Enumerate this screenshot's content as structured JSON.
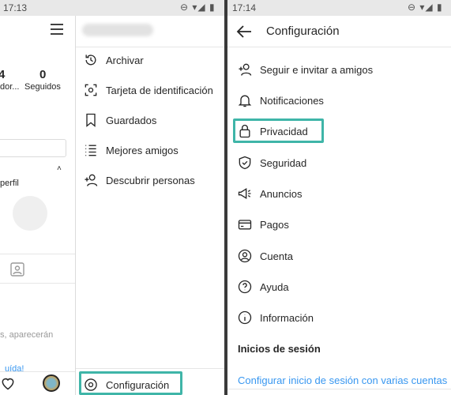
{
  "left_screen": {
    "status_time": "17:13",
    "profile_stats": {
      "followers_count": "4",
      "followers_label": "dor...",
      "following_count": "0",
      "following_label": "Seguidos"
    },
    "profile_section_label": "perfil",
    "empty_text": "s, aparecerán",
    "link_text": "uída!"
  },
  "drawer": {
    "items": [
      {
        "label": "Archivar",
        "icon": "archive-icon"
      },
      {
        "label": "Tarjeta de identificación",
        "icon": "nametag-icon"
      },
      {
        "label": "Guardados",
        "icon": "bookmark-icon"
      },
      {
        "label": "Mejores amigos",
        "icon": "close-friends-icon"
      },
      {
        "label": "Descubrir personas",
        "icon": "add-person-icon"
      }
    ],
    "settings_label": "Configuración"
  },
  "right_screen": {
    "status_time": "17:14",
    "title": "Configuración",
    "items": [
      {
        "label": "Seguir e invitar a amigos",
        "icon": "add-person-icon"
      },
      {
        "label": "Notificaciones",
        "icon": "bell-icon"
      },
      {
        "label": "Privacidad",
        "icon": "lock-icon"
      },
      {
        "label": "Seguridad",
        "icon": "shield-icon"
      },
      {
        "label": "Anuncios",
        "icon": "megaphone-icon"
      },
      {
        "label": "Pagos",
        "icon": "card-icon"
      },
      {
        "label": "Cuenta",
        "icon": "account-icon"
      },
      {
        "label": "Ayuda",
        "icon": "help-icon"
      },
      {
        "label": "Información",
        "icon": "info-icon"
      }
    ],
    "login_section_title": "Inicios de sesión",
    "multi_login_link": "Configurar inicio de sesión con varias cuentas"
  },
  "colors": {
    "highlight": "#3fb5a8",
    "link": "#3897f0"
  }
}
